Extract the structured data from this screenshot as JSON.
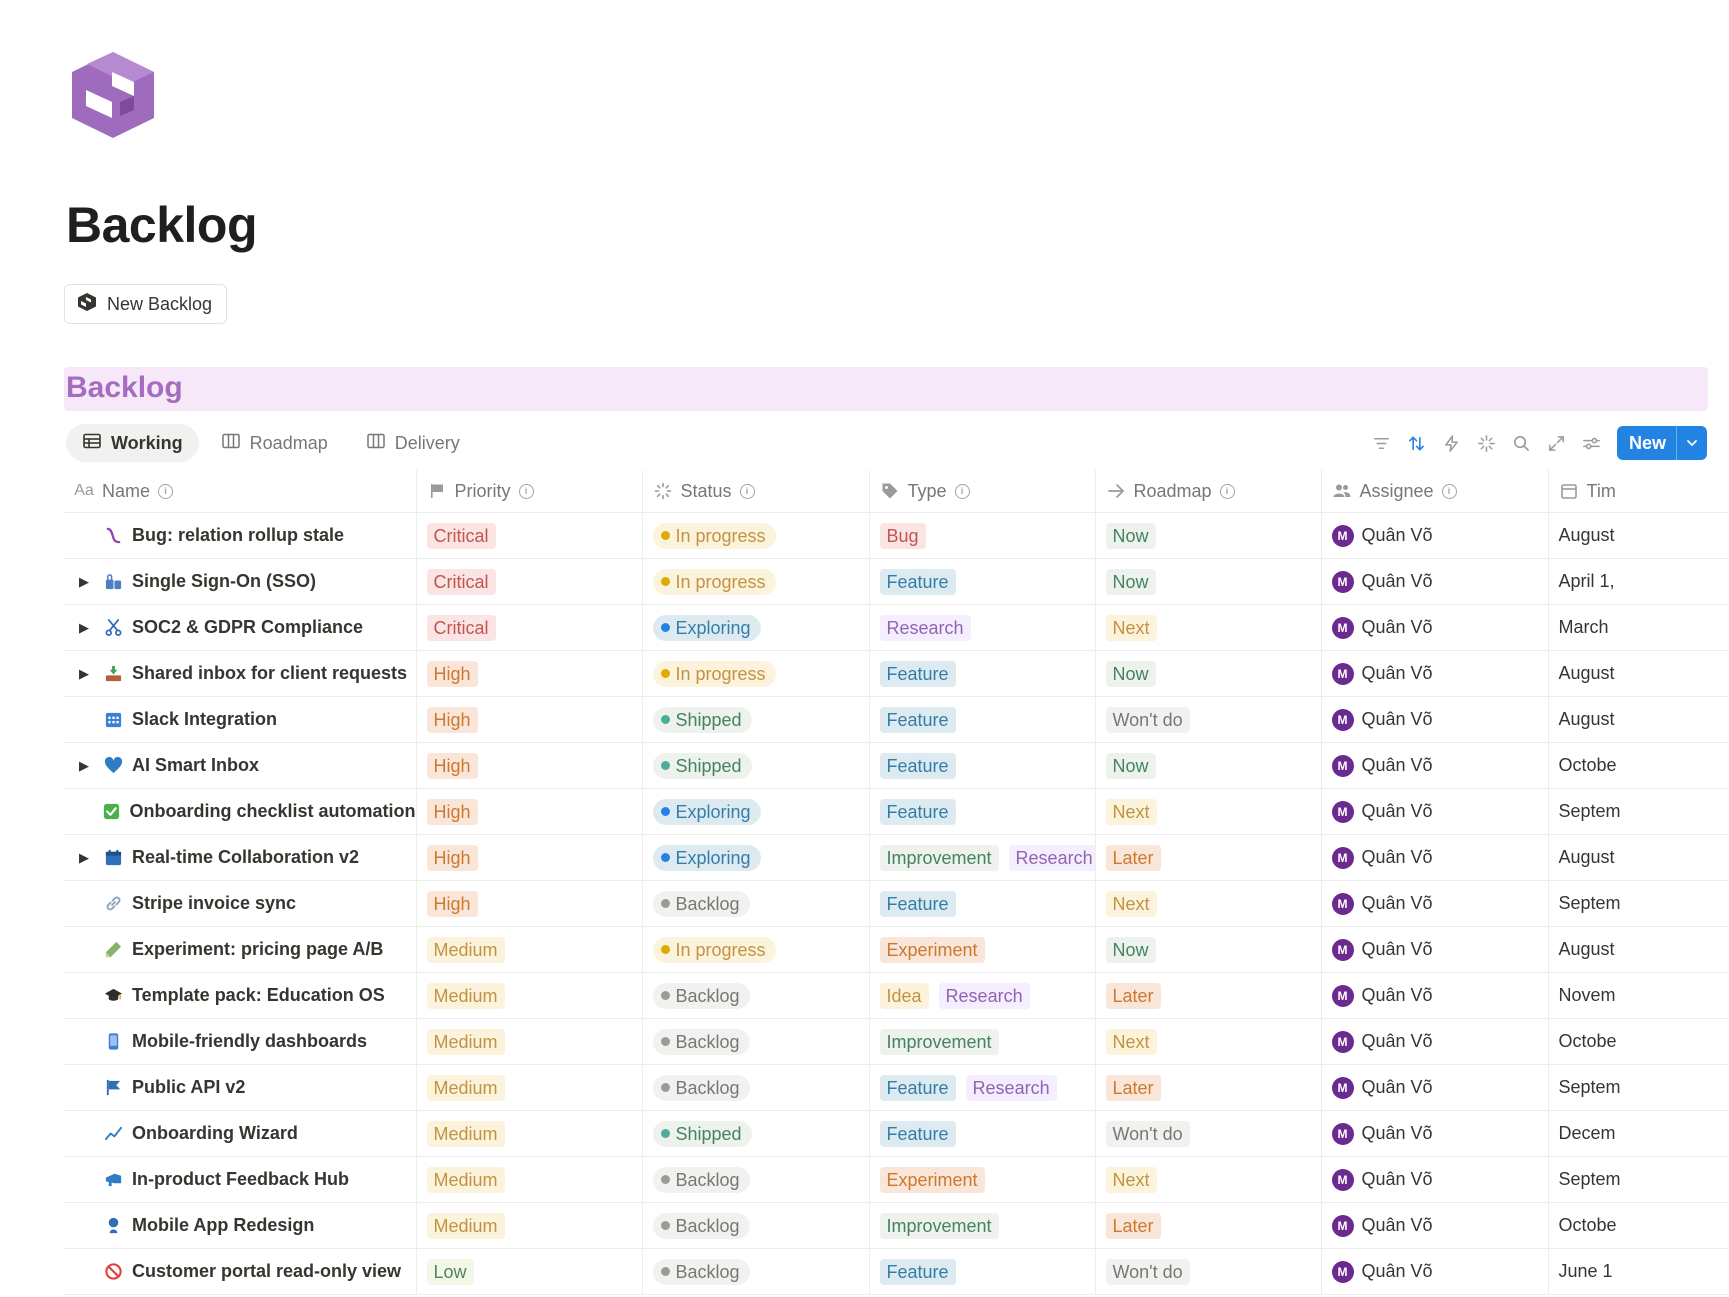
{
  "page": {
    "title": "Backlog",
    "new_button_label": "New Backlog"
  },
  "database": {
    "title": "Backlog"
  },
  "views": [
    {
      "label": "Working",
      "icon": "table-icon",
      "active": true
    },
    {
      "label": "Roadmap",
      "icon": "board-icon",
      "active": false
    },
    {
      "label": "Delivery",
      "icon": "board-icon",
      "active": false
    }
  ],
  "toolbar": {
    "icons": [
      "filter-icon",
      "sort-icon",
      "automation-icon",
      "ai-sparkle-icon",
      "search-icon",
      "expand-icon",
      "settings-icon"
    ],
    "new_label": "New"
  },
  "columns": [
    {
      "label": "Name",
      "icon": "text-property-icon",
      "icon_text": "Aa"
    },
    {
      "label": "Priority",
      "icon": "flag-icon"
    },
    {
      "label": "Status",
      "icon": "status-icon"
    },
    {
      "label": "Type",
      "icon": "tag-icon"
    },
    {
      "label": "Roadmap",
      "icon": "arrow-right-icon"
    },
    {
      "label": "Assignee",
      "icon": "people-icon"
    },
    {
      "label": "Tim",
      "icon": "calendar-icon"
    }
  ],
  "colors": {
    "priority": {
      "Critical": [
        "#fbe4e4",
        "#c4554d"
      ],
      "High": [
        "#fae6d8",
        "#cc782f"
      ],
      "Medium": [
        "#fbf3db",
        "#c29343"
      ],
      "Low": [
        "#f1f8e5",
        "#548164"
      ]
    },
    "status": {
      "In progress": [
        "#fbf3db",
        "#c29343",
        "#dfab01"
      ],
      "Exploring": [
        "#ddebf1",
        "#337ea9",
        "#2383e2"
      ],
      "Shipped": [
        "#edf3ec",
        "#448361",
        "#4dab9a"
      ],
      "Backlog": [
        "#f1f1ef",
        "#787774",
        "#9b9a97"
      ]
    },
    "type": {
      "Bug": [
        "#fbe4e4",
        "#c4554d"
      ],
      "Feature": [
        "#ddebf1",
        "#337ea9"
      ],
      "Research": [
        "#f4eeff",
        "#9065b0"
      ],
      "Improvement": [
        "#edf3ec",
        "#448361"
      ],
      "Experiment": [
        "#fae6d8",
        "#cc782f"
      ],
      "Idea": [
        "#fbf3db",
        "#c29343"
      ]
    },
    "roadmap": {
      "Now": [
        "#edf3ec",
        "#448361"
      ],
      "Next": [
        "#fbf3db",
        "#c29343"
      ],
      "Later": [
        "#fae6d8",
        "#cc782f"
      ],
      "Won't do": [
        "#f1f1ef",
        "#787774"
      ]
    }
  },
  "rows": [
    {
      "name": "Bug: relation rollup stale",
      "icon": "bug-icon",
      "expandable": false,
      "priority": "Critical",
      "status": "In progress",
      "types": [
        "Bug"
      ],
      "roadmap": "Now",
      "assignee": "Quân Võ",
      "avatar": "M",
      "timeline": "August"
    },
    {
      "name": "Single Sign-On (SSO)",
      "icon": "lock-key-icon",
      "expandable": true,
      "priority": "Critical",
      "status": "In progress",
      "types": [
        "Feature"
      ],
      "roadmap": "Now",
      "assignee": "Quân Võ",
      "avatar": "M",
      "timeline": "April 1,"
    },
    {
      "name": "SOC2 & GDPR Compliance",
      "icon": "scissors-icon",
      "expandable": true,
      "priority": "Critical",
      "status": "Exploring",
      "types": [
        "Research"
      ],
      "roadmap": "Next",
      "assignee": "Quân Võ",
      "avatar": "M",
      "timeline": "March"
    },
    {
      "name": "Shared inbox for client requests",
      "icon": "inbox-tray-icon",
      "expandable": true,
      "priority": "High",
      "status": "In progress",
      "types": [
        "Feature"
      ],
      "roadmap": "Now",
      "assignee": "Quân Võ",
      "avatar": "M",
      "timeline": "August"
    },
    {
      "name": "Slack Integration",
      "icon": "calendar-grid-icon",
      "expandable": false,
      "priority": "High",
      "status": "Shipped",
      "types": [
        "Feature"
      ],
      "roadmap": "Won't do",
      "assignee": "Quân Võ",
      "avatar": "M",
      "timeline": "August"
    },
    {
      "name": "AI Smart Inbox",
      "icon": "heart-icon",
      "expandable": true,
      "priority": "High",
      "status": "Shipped",
      "types": [
        "Feature"
      ],
      "roadmap": "Now",
      "assignee": "Quân Võ",
      "avatar": "M",
      "timeline": "Octobe"
    },
    {
      "name": "Onboarding checklist automation",
      "icon": "checkbox-icon",
      "expandable": false,
      "priority": "High",
      "status": "Exploring",
      "types": [
        "Feature"
      ],
      "roadmap": "Next",
      "assignee": "Quân Võ",
      "avatar": "M",
      "timeline": "Septem"
    },
    {
      "name": "Real-time Collaboration v2",
      "icon": "calendar-icon",
      "expandable": true,
      "priority": "High",
      "status": "Exploring",
      "types": [
        "Improvement",
        "Research"
      ],
      "roadmap": "Later",
      "assignee": "Quân Võ",
      "avatar": "M",
      "timeline": "August"
    },
    {
      "name": "Stripe invoice sync",
      "icon": "link-icon",
      "expandable": false,
      "priority": "High",
      "status": "Backlog",
      "types": [
        "Feature"
      ],
      "roadmap": "Next",
      "assignee": "Quân Võ",
      "avatar": "M",
      "timeline": "Septem"
    },
    {
      "name": "Experiment: pricing page A/B",
      "icon": "pencil-icon",
      "expandable": false,
      "priority": "Medium",
      "status": "In progress",
      "types": [
        "Experiment"
      ],
      "roadmap": "Now",
      "assignee": "Quân Võ",
      "avatar": "M",
      "timeline": "August"
    },
    {
      "name": "Template pack: Education OS",
      "icon": "graduation-cap-icon",
      "expandable": false,
      "priority": "Medium",
      "status": "Backlog",
      "types": [
        "Idea",
        "Research"
      ],
      "roadmap": "Later",
      "assignee": "Quân Võ",
      "avatar": "M",
      "timeline": "Novem"
    },
    {
      "name": "Mobile-friendly dashboards",
      "icon": "phone-icon",
      "expandable": false,
      "priority": "Medium",
      "status": "Backlog",
      "types": [
        "Improvement"
      ],
      "roadmap": "Next",
      "assignee": "Quân Võ",
      "avatar": "M",
      "timeline": "Octobe"
    },
    {
      "name": "Public API v2",
      "icon": "flag-icon",
      "expandable": false,
      "priority": "Medium",
      "status": "Backlog",
      "types": [
        "Feature",
        "Research"
      ],
      "roadmap": "Later",
      "assignee": "Quân Võ",
      "avatar": "M",
      "timeline": "Septem"
    },
    {
      "name": "Onboarding Wizard",
      "icon": "line-chart-icon",
      "expandable": false,
      "priority": "Medium",
      "status": "Shipped",
      "types": [
        "Feature"
      ],
      "roadmap": "Won't do",
      "assignee": "Quân Võ",
      "avatar": "M",
      "timeline": "Decem"
    },
    {
      "name": "In-product Feedback Hub",
      "icon": "megaphone-icon",
      "expandable": false,
      "priority": "Medium",
      "status": "Backlog",
      "types": [
        "Experiment"
      ],
      "roadmap": "Next",
      "assignee": "Quân Võ",
      "avatar": "M",
      "timeline": "Septem"
    },
    {
      "name": "Mobile App Redesign",
      "icon": "person-icon",
      "expandable": false,
      "priority": "Medium",
      "status": "Backlog",
      "types": [
        "Improvement"
      ],
      "roadmap": "Later",
      "assignee": "Quân Võ",
      "avatar": "M",
      "timeline": "Octobe"
    },
    {
      "name": "Customer portal read-only view",
      "icon": "prohibited-icon",
      "expandable": false,
      "priority": "Low",
      "status": "Backlog",
      "types": [
        "Feature"
      ],
      "roadmap": "Won't do",
      "assignee": "Quân Võ",
      "avatar": "M",
      "timeline": "June 1"
    }
  ]
}
